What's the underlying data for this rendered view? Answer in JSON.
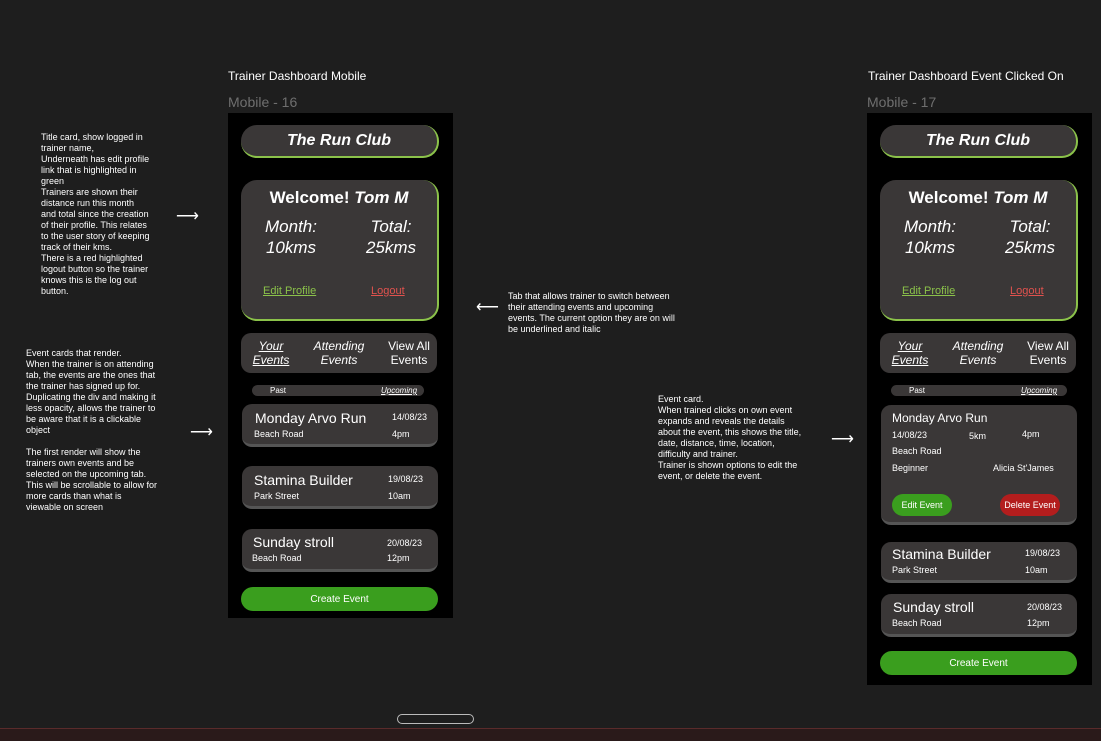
{
  "frames": [
    {
      "title": "Trainer Dashboard Mobile",
      "label": "Mobile - 16"
    },
    {
      "title": "Trainer Dashboard Event Clicked On",
      "label": "Mobile - 17"
    }
  ],
  "notes": {
    "title_card": "Title card, show logged in\ntrainer name,\nUnderneath has edit profile\nlink that is highlighted in\ngreen\nTrainers are shown their\ndistance run this month\nand total since the creation\nof their profile. This relates\nto the user story of keeping\ntrack of their kms.\nThere is a red highlighted\nlogout button so the trainer\nknows this is the log out\nbutton.",
    "tabs": "Tab that allows trainer to switch between\ntheir attending events and upcoming\nevents. The current option they are on will\nbe underlined and italic",
    "event_cards": "Event cards that render.\nWhen the trainer is on attending\ntab, the events are the ones that\nthe trainer has signed up for.\nDuplicating the div and making it\nless opacity, allows the trainer to\nbe aware that it is a clickable\nobject\n\nThe first render will show the\ntrainers own events and be\nselected on the upcoming tab.\nThis will be scrollable to allow for\nmore cards than what is\nviewable on screen",
    "event_card_expanded": "Event card.\nWhen trained clicks on own event\nexpands and reveals the details\nabout the event, this shows the title,\ndate, distance, time, location,\ndifficulty and trainer.\nTrainer is shown options to edit the\nevent, or delete the event.",
    "arrow": "⟶",
    "arrow_left": "⟵"
  },
  "app": {
    "title": "The Run Club",
    "welcome_prefix": "Welcome! ",
    "trainer_name": "Tom M",
    "month_label": "Month:",
    "month_value": "10kms",
    "total_label": "Total:",
    "total_value": "25kms",
    "edit_profile": "Edit Profile",
    "logout": "Logout",
    "tabs": [
      {
        "line1": "Your",
        "line2": "Events"
      },
      {
        "line1": "Attending",
        "line2": "Events"
      },
      {
        "line1": "View All",
        "line2": "Events"
      }
    ],
    "subtabs": {
      "past": "Past",
      "upcoming": "Upcoming"
    },
    "create_event": "Create Event"
  },
  "events": [
    {
      "title": "Monday Arvo Run",
      "location": "Beach Road",
      "date": "14/08/23",
      "time": "4pm"
    },
    {
      "title": "Stamina Builder",
      "location": "Park Street",
      "date": "19/08/23",
      "time": "10am"
    },
    {
      "title": "Sunday stroll",
      "location": "Beach Road",
      "date": "20/08/23",
      "time": "12pm"
    }
  ],
  "expanded_event": {
    "title": "Monday Arvo Run",
    "date": "14/08/23",
    "distance": "5km",
    "time": "4pm",
    "location": "Beach Road",
    "difficulty": "Beginner",
    "trainer": "Alicia St'James",
    "edit": "Edit Event",
    "delete": "Delete Event"
  },
  "colors": {
    "accent_green": "#8bc24a",
    "button_green": "#3a9e1e",
    "logout_red": "#e0524e",
    "delete_red": "#b31d1d",
    "card_bg": "#3a3737"
  }
}
